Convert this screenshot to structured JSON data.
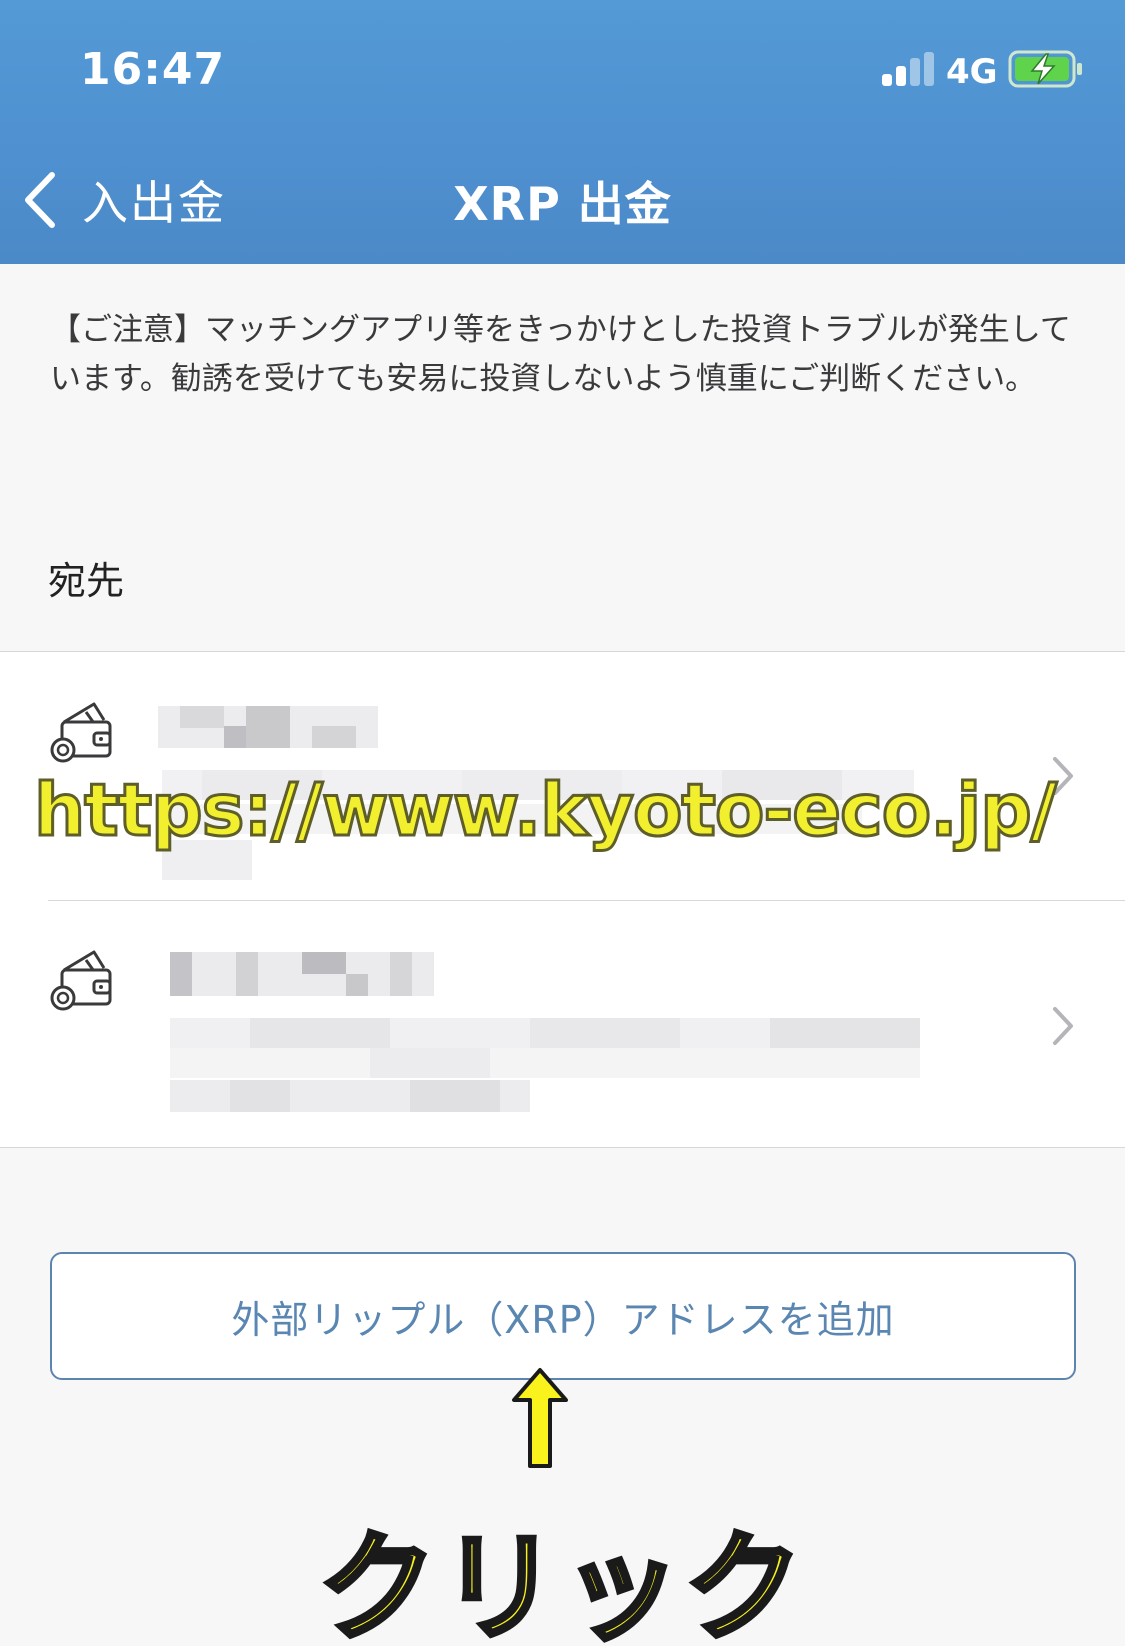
{
  "status_bar": {
    "time": "16:47",
    "network": "4G"
  },
  "nav": {
    "back_label": "入出金",
    "title": "XRP 出金"
  },
  "notice": {
    "text": "【ご注意】マッチングアプリ等をきっかけとした投資トラブルが発生しています。勧誘を受けても安易に投資しないよう慎重にご判断ください。"
  },
  "destination": {
    "label": "宛先",
    "items": [
      {
        "icon": "wallet-icon",
        "content": "blurred"
      },
      {
        "icon": "wallet-icon",
        "content": "blurred"
      }
    ]
  },
  "watermark": {
    "text": "https://www.kyoto-eco.jp/"
  },
  "add_button": {
    "label": "外部リップル（XRP）アドレスを追加"
  },
  "annotation": {
    "click_text": "クリック"
  },
  "colors": {
    "header": "#4f90d0",
    "accent": "#5a86b2",
    "annotation_yellow": "#f9f21c"
  }
}
